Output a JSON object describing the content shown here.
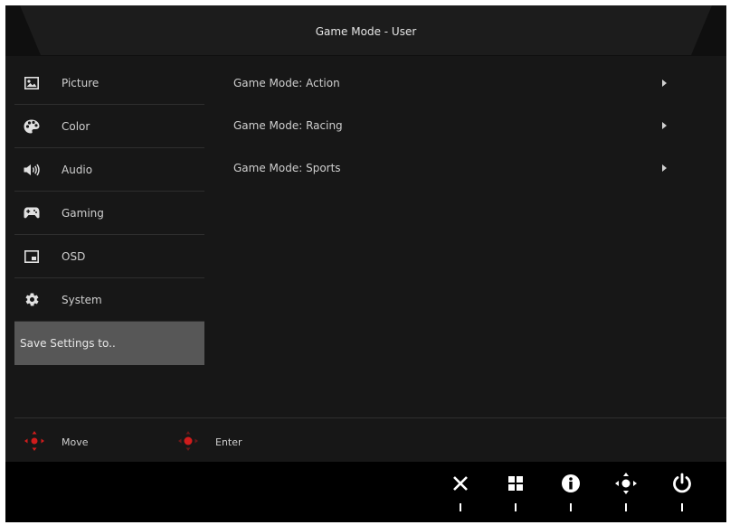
{
  "header": {
    "title": "Game Mode - User"
  },
  "sidebar": {
    "items": [
      {
        "label": "Picture",
        "icon": "picture-icon"
      },
      {
        "label": "Color",
        "icon": "palette-icon"
      },
      {
        "label": "Audio",
        "icon": "speaker-icon"
      },
      {
        "label": "Gaming",
        "icon": "gamepad-icon"
      },
      {
        "label": "OSD",
        "icon": "osd-icon"
      },
      {
        "label": "System",
        "icon": "gear-icon"
      },
      {
        "label": "Save Settings to.."
      }
    ]
  },
  "main": {
    "items": [
      {
        "label": "Game Mode: Action"
      },
      {
        "label": "Game Mode: Racing"
      },
      {
        "label": "Game Mode: Sports"
      }
    ]
  },
  "hints": {
    "move": "Move",
    "enter": "Enter"
  },
  "buttons": [
    {
      "icon": "close-icon"
    },
    {
      "icon": "menu-grid-icon"
    },
    {
      "icon": "info-icon"
    },
    {
      "icon": "joystick-icon"
    },
    {
      "icon": "power-icon"
    }
  ],
  "colors": {
    "accent": "#d01c1c",
    "panel": "#171717",
    "selected": "#575757"
  }
}
